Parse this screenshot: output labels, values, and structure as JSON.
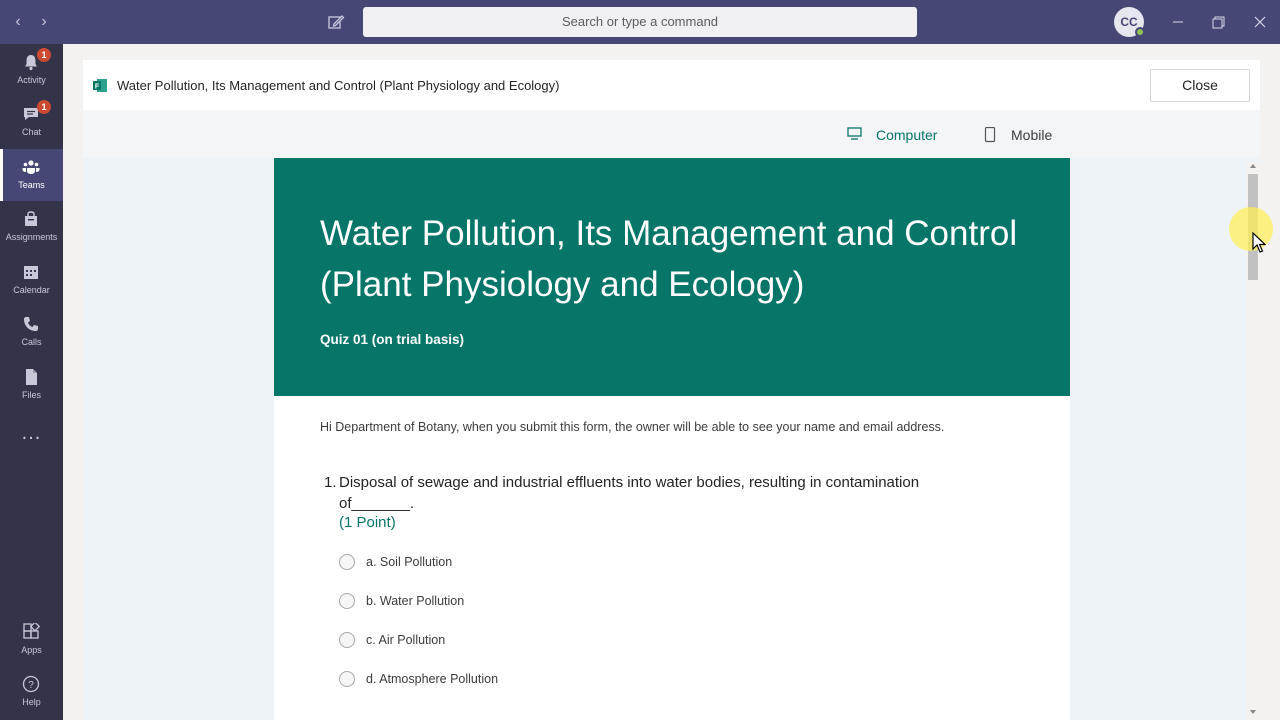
{
  "titlebar": {
    "search_placeholder": "Search or type a command",
    "avatar_initials": "CC"
  },
  "rail": {
    "items": [
      {
        "label": "Activity",
        "badge": "1"
      },
      {
        "label": "Chat",
        "badge": "1"
      },
      {
        "label": "Teams"
      },
      {
        "label": "Assignments"
      },
      {
        "label": "Calendar"
      },
      {
        "label": "Calls"
      },
      {
        "label": "Files"
      },
      {
        "label": "Apps"
      },
      {
        "label": "Help"
      }
    ],
    "more": "..."
  },
  "header": {
    "title": "Water Pollution, Its Management and Control (Plant Physiology and Ecology)",
    "close_label": "Close"
  },
  "view_toggle": {
    "computer": "Computer",
    "mobile": "Mobile",
    "selected": "Computer"
  },
  "form": {
    "title": "Water Pollution, Its Management and Control (Plant Physiology and Ecology)",
    "subtitle": "Quiz 01 (on trial basis)",
    "notice": "Hi Department of Botany, when you submit this form, the owner will be able to see your name and email address.",
    "question": {
      "number": "1.",
      "text": "Disposal of sewage and industrial effluents into water bodies, resulting in contamination of_______.",
      "points": "(1 Point)",
      "options": [
        "a. Soil Pollution",
        "b. Water Pollution",
        "c. Air Pollution",
        "d. Atmosphere Pollution"
      ]
    }
  },
  "colors": {
    "titlebar": "#464775",
    "rail": "#33344a",
    "accent": "#077568",
    "badge": "#cc4a31"
  }
}
